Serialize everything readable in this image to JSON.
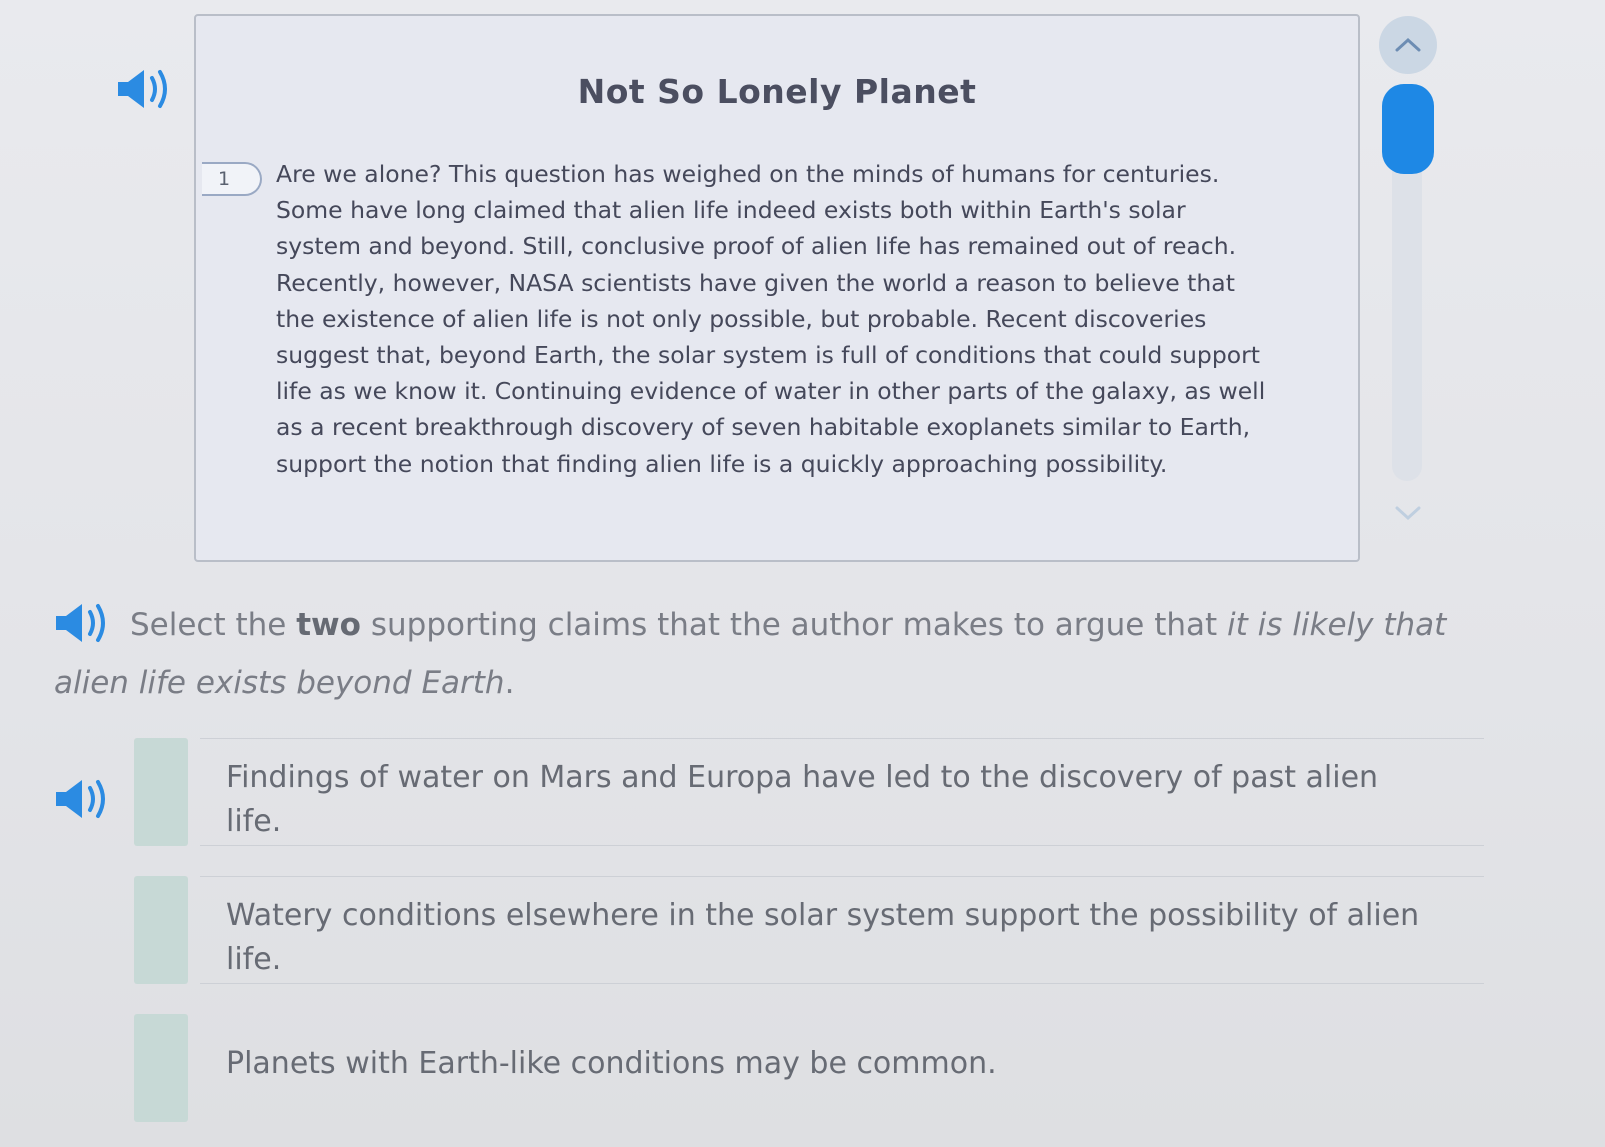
{
  "passage": {
    "title": "Not So Lonely Planet",
    "paragraph_number": "1",
    "paragraph_text": "Are we alone? This question has weighed on the minds of humans for centuries. Some have long claimed that alien life indeed exists both within Earth's solar system and beyond. Still, conclusive proof of alien life has remained out of reach. Recently, however, NASA scientists have given the world a reason to believe that the existence of alien life is not only possible, but probable. Recent discoveries suggest that, beyond Earth, the solar system is full of conditions that could support life as we know it. Continuing evidence of water in other parts of the galaxy, as well as a recent breakthrough discovery of seven habitable exoplanets similar to Earth, support the notion that finding alien life is a quickly approaching possibility."
  },
  "question": {
    "prefix": "Select the ",
    "emphasis": "two",
    "middle": " supporting claims that the author makes to argue that ",
    "italic": "it is likely that alien life exists beyond Earth",
    "suffix": "."
  },
  "options": [
    {
      "text": "Findings of water on Mars and Europa have led to the discovery of past alien life."
    },
    {
      "text": "Watery conditions elsewhere in the solar system support the possibility of alien life."
    },
    {
      "text": "Planets with Earth-like conditions may be common."
    }
  ],
  "icons": {
    "audio": "speaker-icon",
    "scroll_up": "chevron-up-icon",
    "scroll_down": "chevron-down-icon"
  },
  "colors": {
    "accent": "#1e88e5",
    "speaker": "#2b8be2",
    "checkbox": "#c7d9d6"
  }
}
